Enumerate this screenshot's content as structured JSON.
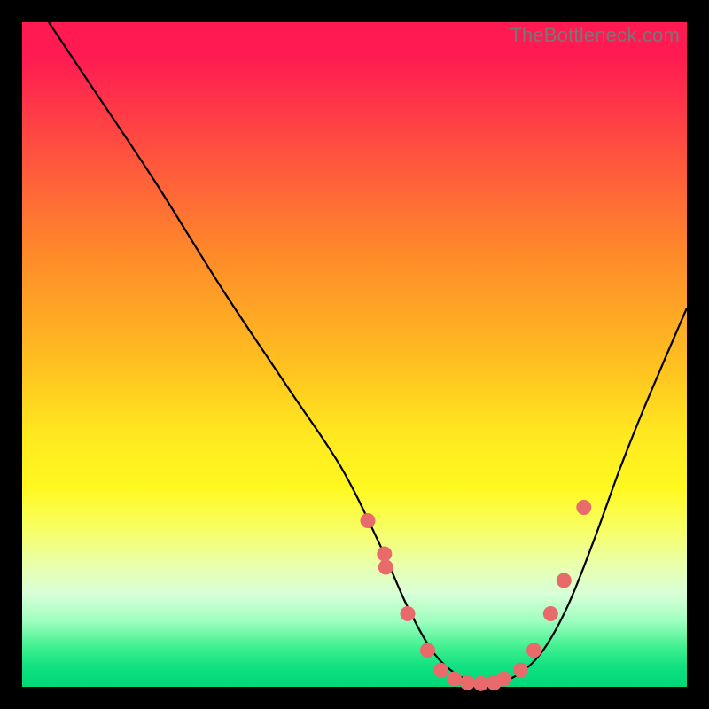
{
  "watermark": "TheBottleneck.com",
  "chart_data": {
    "type": "line",
    "title": "",
    "xlabel": "",
    "ylabel": "",
    "xlim": [
      0,
      100
    ],
    "ylim": [
      0,
      100
    ],
    "grid": false,
    "series": [
      {
        "name": "curve",
        "x": [
          4,
          10,
          20,
          30,
          40,
          48,
          54,
          58,
          62,
          66,
          70,
          74,
          78,
          82,
          86,
          90,
          94,
          100
        ],
        "y": [
          100,
          91,
          76,
          60,
          45,
          33,
          21,
          12,
          5,
          1.5,
          0.5,
          1.5,
          5,
          12,
          22,
          33,
          43,
          57
        ]
      }
    ],
    "markers": {
      "name": "highlight-dots",
      "x": [
        52.0,
        54.5,
        54.7,
        58.0,
        61.0,
        63.0,
        65.0,
        67.0,
        69.0,
        71.0,
        72.5,
        75.0,
        77.0,
        79.5,
        81.5,
        84.5
      ],
      "y": [
        25.0,
        20.0,
        18.0,
        11.0,
        5.5,
        2.5,
        1.2,
        0.6,
        0.5,
        0.6,
        1.2,
        2.5,
        5.5,
        11.0,
        16.0,
        27.0
      ]
    }
  }
}
